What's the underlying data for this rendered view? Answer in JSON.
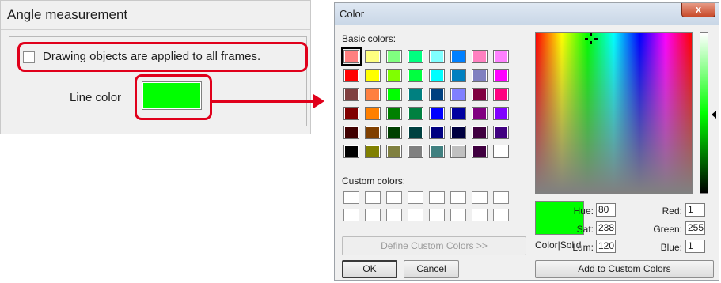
{
  "angle_panel": {
    "title": "Angle measurement",
    "checkbox_label": "Drawing objects are applied to all frames.",
    "line_color_label": "Line color",
    "line_color_value": "#00ff00",
    "highlight_color": "#e0001b"
  },
  "color_dialog": {
    "title": "Color",
    "close_glyph": "x",
    "basic_colors_label": "Basic colors:",
    "basic_colors": [
      [
        "#ff8080",
        "#ffff80",
        "#80ff80",
        "#00ff80",
        "#80ffff",
        "#0080ff",
        "#ff80c0",
        "#ff80ff"
      ],
      [
        "#ff0000",
        "#ffff00",
        "#80ff00",
        "#00ff40",
        "#00ffff",
        "#0080c0",
        "#8080c0",
        "#ff00ff"
      ],
      [
        "#804040",
        "#ff8040",
        "#00ff00",
        "#008080",
        "#004080",
        "#8080ff",
        "#800040",
        "#ff0080"
      ],
      [
        "#800000",
        "#ff8000",
        "#008000",
        "#008040",
        "#0000ff",
        "#0000a0",
        "#800080",
        "#8000ff"
      ],
      [
        "#400000",
        "#804000",
        "#004000",
        "#004040",
        "#000080",
        "#000040",
        "#400040",
        "#400080"
      ],
      [
        "#000000",
        "#808000",
        "#808040",
        "#808080",
        "#408080",
        "#c0c0c0",
        "#400040",
        "#ffffff"
      ]
    ],
    "custom_colors_label": "Custom colors:",
    "define_custom_label": "Define Custom Colors >>",
    "ok_label": "OK",
    "cancel_label": "Cancel",
    "preview_color": "#00ff00",
    "preview_label": "Color|Solid",
    "hue_label": "Hue:",
    "hue_value": "80",
    "sat_label": "Sat:",
    "sat_value": "238",
    "lum_label": "Lum:",
    "lum_value": "120",
    "red_label": "Red:",
    "red_value": "1",
    "green_label": "Green:",
    "green_value": "255",
    "blue_label": "Blue:",
    "blue_value": "1",
    "add_custom_label": "Add to Custom Colors"
  }
}
